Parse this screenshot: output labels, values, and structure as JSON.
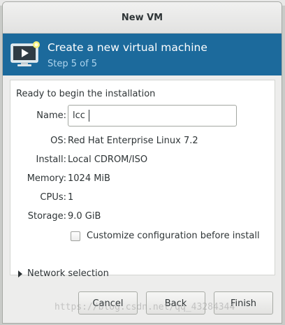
{
  "window": {
    "title": "New VM"
  },
  "banner": {
    "title": "Create a new virtual machine",
    "step": "Step 5 of 5",
    "icon": "monitor-play-icon"
  },
  "summary": {
    "heading": "Ready to begin the installation",
    "name_label": "Name:",
    "name_value": "lcc",
    "os_label": "OS:",
    "os_value": "Red Hat Enterprise Linux 7.2",
    "install_label": "Install:",
    "install_value": "Local CDROM/ISO",
    "memory_label": "Memory:",
    "memory_value": "1024 MiB",
    "cpus_label": "CPUs:",
    "cpus_value": "1",
    "storage_label": "Storage:",
    "storage_value": "9.0 GiB",
    "customize_label": "Customize configuration before install",
    "customize_checked": false
  },
  "network": {
    "label": "Network selection",
    "expanded": false
  },
  "buttons": {
    "cancel": "Cancel",
    "back": "Back",
    "finish": "Finish"
  },
  "watermark": "https://blog.csdn.net/qq_43284344",
  "colors": {
    "banner": "#1c6a9c",
    "banner_step": "#aed5ee",
    "window_bg": "#ededec"
  }
}
